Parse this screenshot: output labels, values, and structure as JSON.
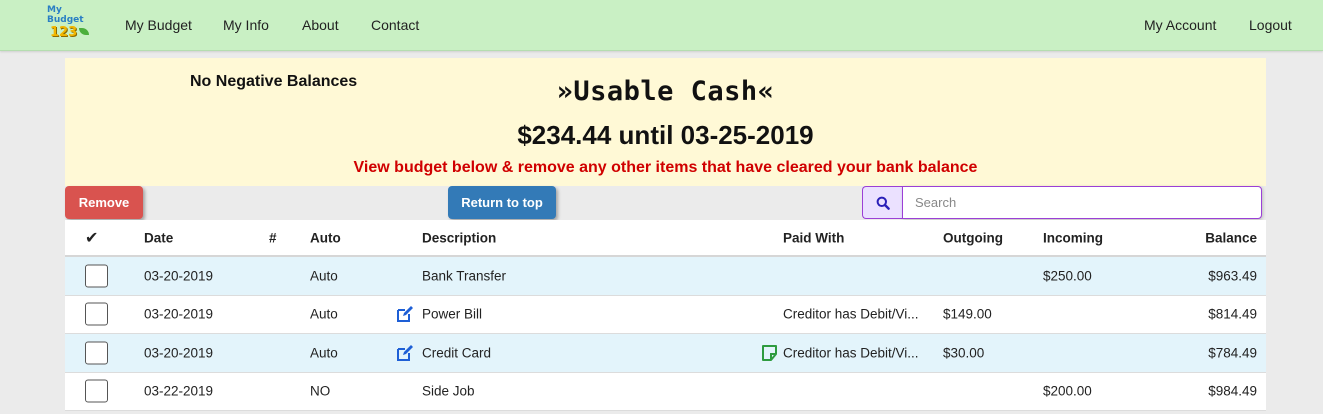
{
  "navbar": {
    "logo": {
      "line1": "My",
      "line2": "Budget",
      "line3": "123"
    },
    "links": [
      "My Budget",
      "My Info",
      "About",
      "Contact"
    ],
    "right_links": [
      "My Account",
      "Logout"
    ]
  },
  "summary": {
    "note": "No Negative Balances",
    "title": "»Usable Cash«",
    "amount": "$234.44 until 03-25-2019",
    "hint": "View budget below & remove any other items that have cleared your bank balance"
  },
  "toolbar": {
    "remove_label": "Remove",
    "top_label": "Return to top",
    "search_placeholder": "Search"
  },
  "table": {
    "headers": {
      "check": "✔",
      "date": "Date",
      "num": "#",
      "auto": "Auto",
      "description": "Description",
      "paid_with": "Paid With",
      "outgoing": "Outgoing",
      "incoming": "Incoming",
      "balance": "Balance"
    },
    "rows": [
      {
        "date": "03-20-2019",
        "num": "",
        "auto": "Auto",
        "description": "Bank Transfer",
        "paid_with": "",
        "outgoing": "",
        "incoming": "$250.00",
        "balance": "$963.49"
      },
      {
        "date": "03-20-2019",
        "num": "",
        "auto": "Auto",
        "description": "Power Bill",
        "paid_with": "Creditor has Debit/Vi...",
        "outgoing": "$149.00",
        "incoming": "",
        "balance": "$814.49"
      },
      {
        "date": "03-20-2019",
        "num": "",
        "auto": "Auto",
        "description": "Credit Card",
        "paid_with": "Creditor has Debit/Vi...",
        "outgoing": "$30.00",
        "incoming": "",
        "balance": "$784.49"
      },
      {
        "date": "03-22-2019",
        "num": "",
        "auto": "NO",
        "description": "Side Job",
        "paid_with": "",
        "outgoing": "",
        "incoming": "$200.00",
        "balance": "$984.49"
      }
    ]
  },
  "colors": {
    "navbar": "#c9f0c4",
    "summary_bg": "#fff9d6",
    "hint": "#d00000",
    "remove": "#d9534f",
    "top": "#337ab7",
    "search_border": "#9b3fd6",
    "row_alt": "#e3f4fb",
    "edit_icon": "#1e5fd6",
    "note_icon": "#2e9b3f"
  }
}
